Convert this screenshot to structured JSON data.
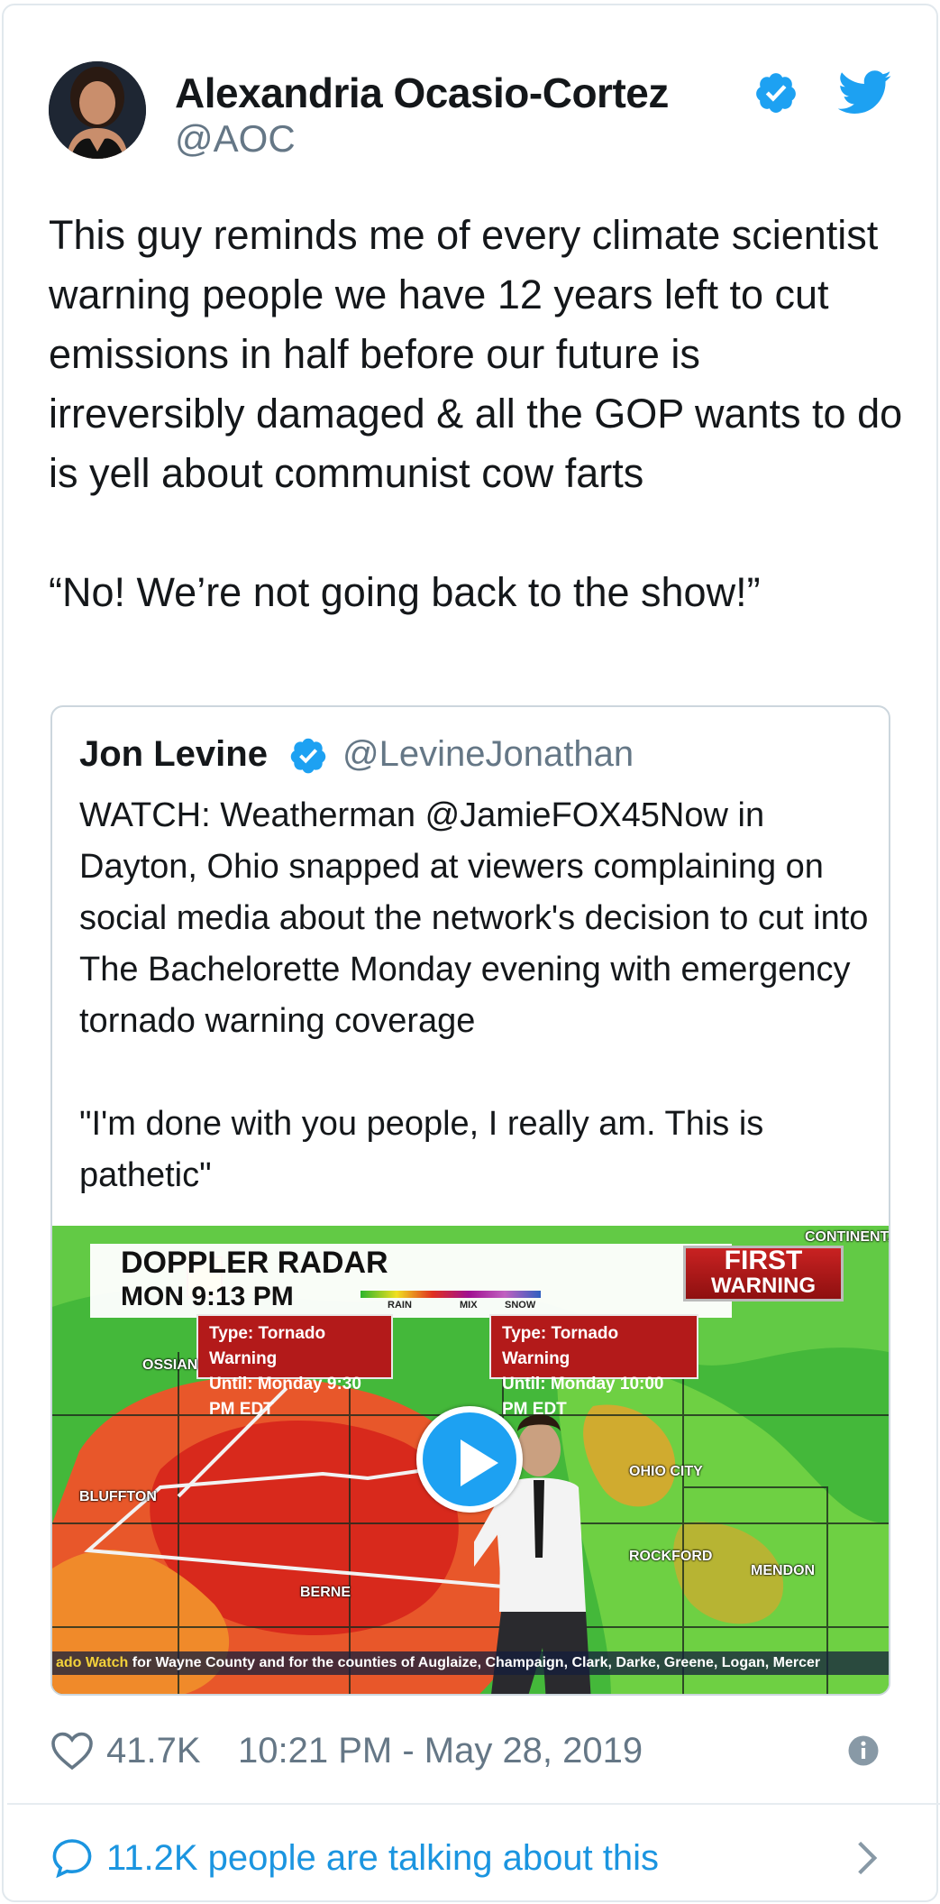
{
  "tweet": {
    "author_name": "Alexandria Ocasio-Cortez",
    "handle": "@AOC",
    "text": "This guy reminds me of every climate scientist warning people we have 12 years left to cut emissions in half before our future is irreversibly damaged & all the GOP wants to do is yell about communist cow farts\n\n“No! We’re not going back to the show!”",
    "likes": "41.7K",
    "timestamp": "10:21 PM - May 28, 2019",
    "talking": "11.2K people are talking about this"
  },
  "quoted": {
    "author_name": "Jon Levine",
    "handle": "@LevineJonathan",
    "text": "WATCH: Weatherman @JamieFOX45Now in Dayton, Ohio snapped at viewers complaining on social media about the network's decision to cut into The Bachelorette Monday evening with emergency tornado warning coverage\n\n\"I'm done with you people, I really am. This is pathetic\""
  },
  "video": {
    "banner_line1": "DOPPLER RADAR",
    "banner_line2": "MON 9:13 PM",
    "legend": [
      "RAIN",
      "MIX",
      "SNOW"
    ],
    "first_warning_1": "FIRST",
    "first_warning_2": "WARNING",
    "warning1_type": "Type: Tornado Warning",
    "warning1_until": "Until: Monday 9:30 PM EDT",
    "warning2_type": "Type: Tornado Warning",
    "warning2_until": "Until: Monday 10:00 PM EDT",
    "towns": [
      "OSSIAN",
      "BLUFFTON",
      "BERNE",
      "OHIO CITY",
      "ROCKFORD",
      "MENDON",
      "CONTINENTAL"
    ],
    "ticker_highlight": "ado Watch",
    "ticker_text": " for Wayne County and for the counties of Auglaize, Champaign, Clark, Darke, Greene, Logan, Mercer"
  },
  "icons": {
    "verified": "verified-badge-icon",
    "bird": "twitter-bird-icon",
    "heart": "heart-icon",
    "info": "info-icon",
    "reply": "speech-bubble-icon",
    "chevron": "chevron-right-icon",
    "play": "play-icon"
  },
  "colors": {
    "twitter_blue": "#1da1f2",
    "link_blue": "#1b95e0",
    "secondary_text": "#657786",
    "border": "#e1e8ed"
  }
}
